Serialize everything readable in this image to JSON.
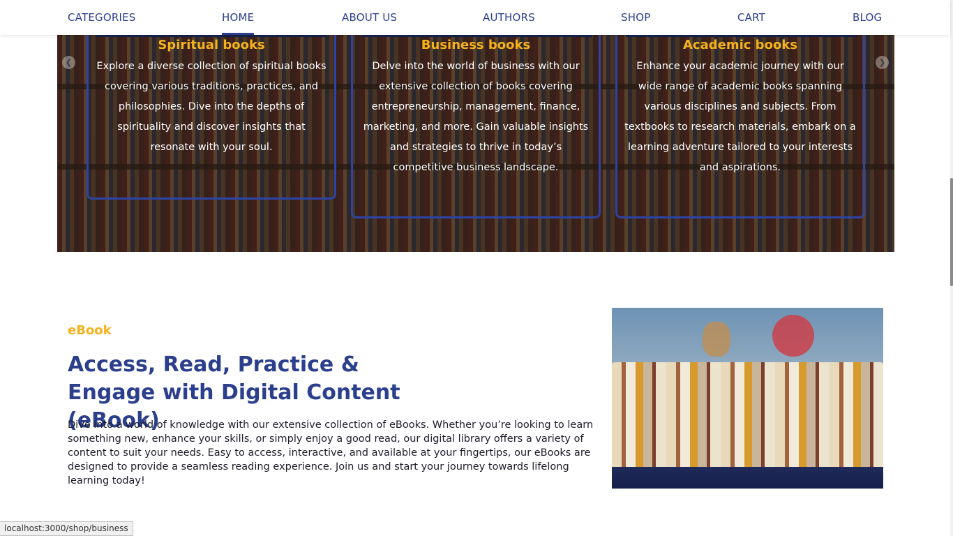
{
  "nav": {
    "items": [
      {
        "label": "CATEGORIES"
      },
      {
        "label": "HOME",
        "active": true
      },
      {
        "label": "ABOUT US"
      },
      {
        "label": "AUTHORS"
      },
      {
        "label": "SHOP"
      },
      {
        "label": "CART"
      },
      {
        "label": "BLOG"
      }
    ]
  },
  "carousel": {
    "prev_icon": "chevron-left-icon",
    "next_icon": "chevron-right-icon",
    "cards": [
      {
        "title": "Spiritual books",
        "text": "Explore a diverse collection of spiritual books covering various traditions, practices, and philosophies. Dive into the depths of spirituality and discover insights that resonate with your soul."
      },
      {
        "title": "Business books",
        "text": "Delve into the world of business with our extensive collection of books covering entrepreneurship, management, finance, marketing, and more. Gain valuable insights and strategies to thrive in today’s competitive business landscape."
      },
      {
        "title": "Academic books",
        "text": "Enhance your academic journey with our wide range of academic books spanning various disciplines and subjects. From textbooks to research materials, embark on a learning adventure tailored to your interests and aspirations."
      }
    ]
  },
  "ebook": {
    "kicker": "eBook",
    "heading": "Access, Read, Practice & Engage with Digital Content (eBook)",
    "body": "Dive into a world of knowledge with our extensive collection of eBooks. Whether you’re looking to learn something new, enhance your skills, or simply enjoy a good read, our digital library offers a variety of content to suit your needs. Easy to access, interactive, and available at your fingertips, our eBooks are designed to provide a seamless reading experience. Join us and start your journey towards lifelong learning today!"
  },
  "status": {
    "url": "localhost:3000/shop/business"
  },
  "colors": {
    "brand_blue": "#2b3f8c",
    "accent_yellow": "#f5b21b",
    "card_border": "#2d44a6"
  }
}
